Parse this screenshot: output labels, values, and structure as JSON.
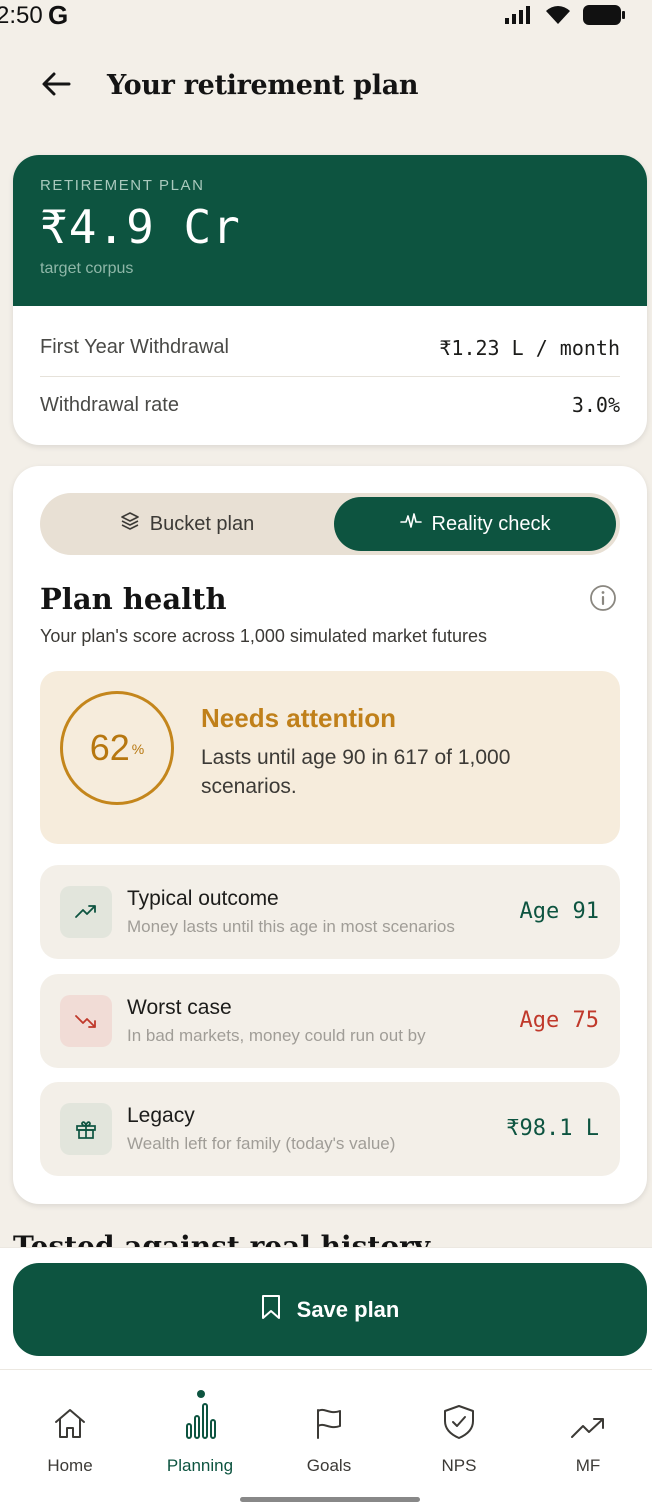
{
  "status_bar": {
    "time": "2:50",
    "g_badge": "G",
    "icons": [
      "signal-icon",
      "wifi-icon",
      "battery-icon"
    ]
  },
  "header": {
    "title": "Your retirement plan",
    "back_icon": "arrow-left-icon"
  },
  "summary": {
    "eyebrow": "RETIREMENT PLAN",
    "amount": "₹4.9 Cr",
    "subtitle": "target corpus",
    "rows": [
      {
        "label": "First Year Withdrawal",
        "value": "₹1.23 L / month"
      },
      {
        "label": "Withdrawal rate",
        "value": "3.0%"
      }
    ]
  },
  "toggle": {
    "options": [
      {
        "label": "Bucket plan",
        "icon": "layers-icon",
        "active": false
      },
      {
        "label": "Reality check",
        "icon": "pulse-icon",
        "active": true
      }
    ]
  },
  "plan_health": {
    "title": "Plan health",
    "subtitle": "Your plan's score across 1,000 simulated market futures",
    "score": {
      "value": "62",
      "unit": "%",
      "status": "Needs attention",
      "description": "Lasts until age 90 in 617 of 1,000 scenarios.",
      "color": "#c0801a"
    },
    "metrics": [
      {
        "title": "Typical outcome",
        "subtitle": "Money lasts until this age in most scenarios",
        "value": "Age 91",
        "icon": "trending-up-icon",
        "tone": "green"
      },
      {
        "title": "Worst case",
        "subtitle": "In bad markets, money could run out by",
        "value": "Age 75",
        "icon": "trending-down-icon",
        "tone": "red"
      },
      {
        "title": "Legacy",
        "subtitle": "Wealth left for family (today's value)",
        "value": "₹98.1 L",
        "icon": "gift-icon",
        "tone": "green"
      }
    ]
  },
  "next_section_heading": "Tested against real history",
  "save_button": {
    "label": "Save plan",
    "icon": "bookmark-icon"
  },
  "bottom_nav": {
    "items": [
      {
        "label": "Home",
        "icon": "home-icon",
        "active": false
      },
      {
        "label": "Planning",
        "icon": "bar-chart-icon",
        "active": true
      },
      {
        "label": "Goals",
        "icon": "flag-icon",
        "active": false
      },
      {
        "label": "NPS",
        "icon": "shield-check-icon",
        "active": false
      },
      {
        "label": "MF",
        "icon": "trending-up-icon",
        "active": false
      }
    ]
  },
  "colors": {
    "brand_green": "#0d5440",
    "warning_amber": "#c0801a",
    "danger_red": "#c0392b",
    "background": "#f3efe8"
  }
}
